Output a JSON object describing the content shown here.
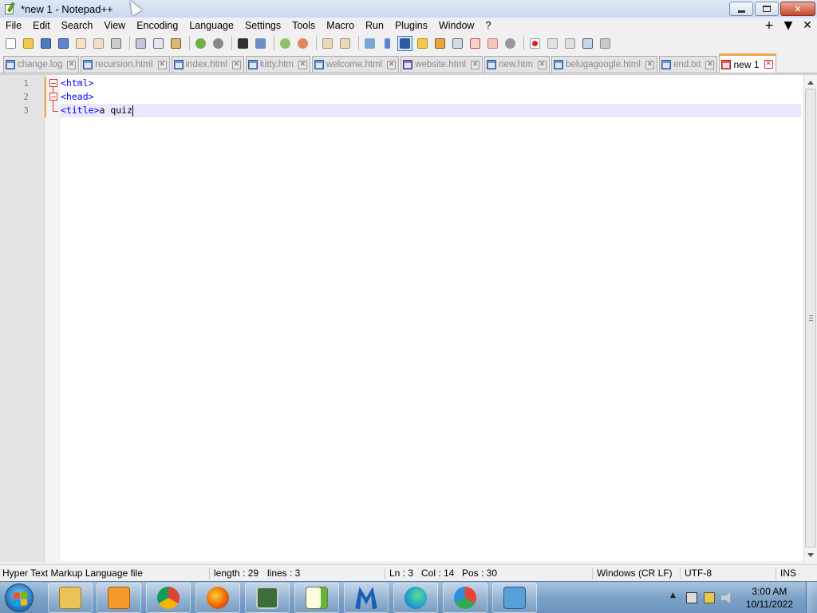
{
  "window": {
    "title": "*new 1 - Notepad++",
    "minimize_label": "",
    "maximize_label": "",
    "close_label": "✕"
  },
  "menu": {
    "items": [
      "File",
      "Edit",
      "Search",
      "View",
      "Encoding",
      "Language",
      "Settings",
      "Tools",
      "Macro",
      "Run",
      "Plugins",
      "Window",
      "?"
    ],
    "right": [
      "+",
      "▼",
      "✕"
    ]
  },
  "tabs": [
    {
      "label": "change.log",
      "active": false
    },
    {
      "label": "recursion.html",
      "active": false
    },
    {
      "label": "index.html",
      "active": false
    },
    {
      "label": "kitty.htm",
      "active": false
    },
    {
      "label": "welcome.html",
      "active": false
    },
    {
      "label": "website.html",
      "active": false
    },
    {
      "label": "new.htm",
      "active": false
    },
    {
      "label": "belugagoogle.html",
      "active": false
    },
    {
      "label": "end.txt",
      "active": false
    },
    {
      "label": "new 1",
      "active": true
    }
  ],
  "tab_close_glyph": "✕",
  "editor": {
    "line_numbers": [
      "1",
      "2",
      "3"
    ],
    "lines": [
      {
        "tag": "<html>",
        "text": ""
      },
      {
        "tag": "<head>",
        "text": ""
      },
      {
        "tag": "<title>",
        "text": "a quiz"
      }
    ],
    "current_line": 3
  },
  "statusbar": {
    "file_type": "Hyper Text Markup Language file",
    "length": "length : 29",
    "lines": "lines : 3",
    "ln": "Ln : 3",
    "col": "Col : 14",
    "pos": "Pos : 30",
    "eol": "Windows (CR LF)",
    "encoding": "UTF-8",
    "mode": "INS"
  },
  "taskbar": {
    "clock_time": "3:00 AM",
    "clock_date": "10/11/2022",
    "tray_arrow": "▲",
    "apps": [
      {
        "name": "file-explorer",
        "color": "#e9c25a"
      },
      {
        "name": "media-player",
        "color": "#f39a2b"
      },
      {
        "name": "chrome",
        "color": "#db4437"
      },
      {
        "name": "firefox",
        "color": "#e66000"
      },
      {
        "name": "terminal",
        "color": "#3b6e3b"
      },
      {
        "name": "notepad-plus-plus",
        "color": "#6bb33b"
      },
      {
        "name": "malwarebytes",
        "color": "#1a5fb4"
      },
      {
        "name": "edge",
        "color": "#1f9bd1"
      },
      {
        "name": "chrome-canary",
        "color": "#2f8fd8"
      },
      {
        "name": "control-panel",
        "color": "#5aa0d8"
      }
    ]
  },
  "colors": {
    "accent_tab": "#f5a74a",
    "tag_blue": "#0000ff",
    "current_line": "#e8e8ff"
  }
}
